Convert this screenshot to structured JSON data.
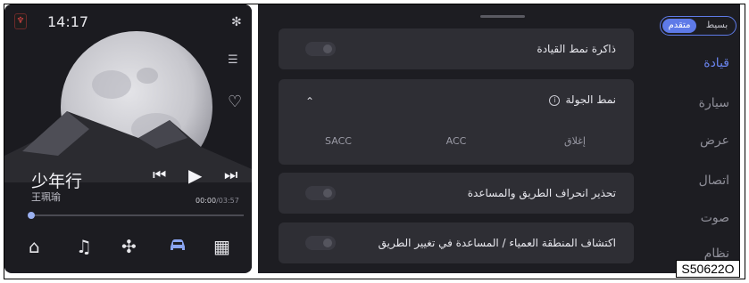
{
  "status": {
    "time": "14:17",
    "logo_icon": "brand-logo-icon",
    "bluetooth_icon": "bluetooth-icon"
  },
  "media": {
    "song_title": "少年行",
    "artist": "王珮瑜",
    "elapsed": "00:00",
    "duration": "/03:57",
    "progress": 0.0,
    "controls": [
      "previous-icon",
      "play-icon",
      "next-icon"
    ],
    "side_icons": [
      "playlist-icon",
      "heart-icon"
    ]
  },
  "bottom_nav": {
    "items": [
      "home-icon",
      "music-icon",
      "fan-icon",
      "car-icon",
      "apps-icon"
    ],
    "active": "car-icon"
  },
  "settings": {
    "cards": [
      {
        "label": "ذاكرة نمط القيادة",
        "toggle_on": false
      },
      {
        "label": "نمط الجولة",
        "expanded": true,
        "info_icon": "info-icon",
        "options": [
          "إغلاق",
          "ACC",
          "SACC"
        ],
        "selected": "SACC"
      },
      {
        "label": "تحذير انحراف الطريق والمساعدة",
        "toggle_on": false
      },
      {
        "label": "اكتشاف المنطقة العمياء / المساعدة في تغيير الطريق",
        "toggle_on": false
      }
    ]
  },
  "sidebar": {
    "mode_advanced": "متقدم",
    "mode_basic": "بسيط",
    "mode_selected": "متقدم",
    "categories": [
      "قيادة",
      "سيارة",
      "عرض",
      "اتصال",
      "صوت",
      "نظام"
    ],
    "active": "قيادة"
  },
  "reference_code": "S50622O",
  "colors": {
    "accent": "#6a84ee",
    "panel": "#1d1d22",
    "card": "#2e2e34",
    "selected_segment": "#6e78b4"
  }
}
